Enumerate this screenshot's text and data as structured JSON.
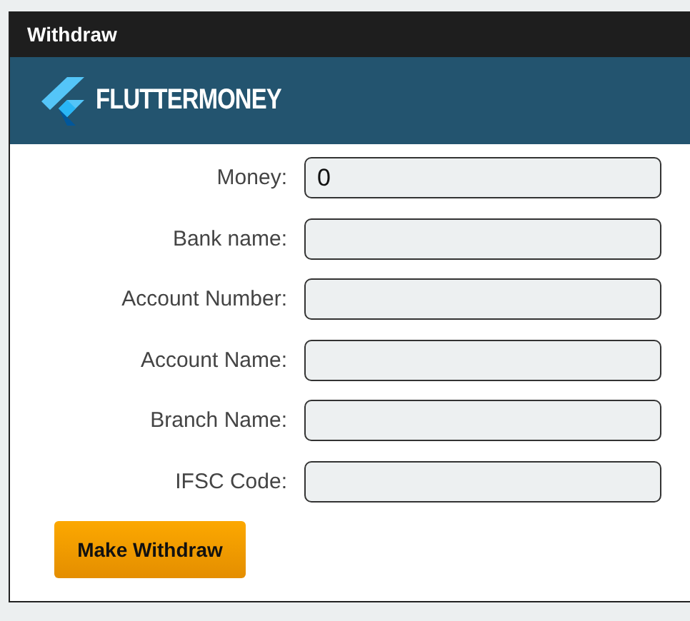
{
  "window": {
    "title": "Withdraw"
  },
  "logo": {
    "text": "FLUTTERMONEY"
  },
  "fields": [
    {
      "label": "Money:",
      "value": "0"
    },
    {
      "label": "Bank name:"
    },
    {
      "label": "Account Number:"
    },
    {
      "label": "Account Name:"
    },
    {
      "label": "Branch Name:"
    },
    {
      "label": "IFSC Code:"
    }
  ],
  "submit_button": "Make Withdraw"
}
